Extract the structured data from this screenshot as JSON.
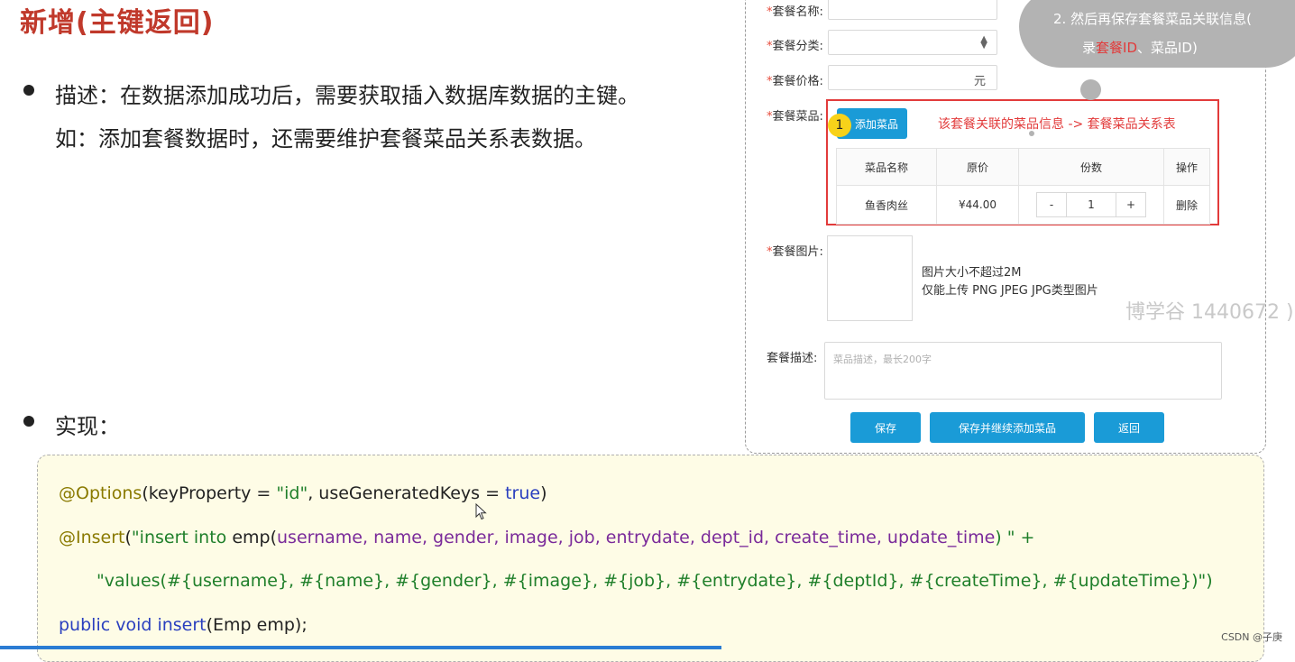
{
  "slide": {
    "title": "新增(主键返回)",
    "description_label": "描述：在数据添加成功后，需要获取插入数据库数据的主键。",
    "description_example": "如：添加套餐数据时，还需要维护套餐菜品关系表数据。",
    "implementation_label": "实现："
  },
  "form": {
    "name_label": "套餐名称:",
    "category_label": "套餐分类:",
    "price_label": "套餐价格:",
    "price_unit": "元",
    "dishes_label": "套餐菜品:",
    "add_dish_button": "添加菜品",
    "step_badge": "1",
    "dish_relation_note": "该套餐关联的菜品信息 -> 套餐菜品关系表",
    "table": {
      "headers": [
        "菜品名称",
        "原价",
        "份数",
        "操作"
      ],
      "rows": [
        {
          "name": "鱼香肉丝",
          "price": "¥44.00",
          "qty": "1",
          "action": "删除"
        }
      ],
      "minus": "-",
      "plus": "+"
    },
    "image_label": "套餐图片:",
    "image_hint_1": "图片大小不超过2M",
    "image_hint_2": "仅能上传 PNG JPEG JPG类型图片",
    "desc_label": "套餐描述:",
    "desc_placeholder": "菜品描述，最长200字",
    "save_button": "保存",
    "save_continue_button": "保存并继续添加菜品",
    "back_button": "返回",
    "required_mark": "*"
  },
  "cloud": {
    "line1": "2.  然后再保存套餐菜品关联信息(",
    "line2_prefix": "录",
    "line2_red1": "套餐ID",
    "line2_mid": "、菜品ID)"
  },
  "watermark": "博学谷 1440672 )",
  "code": {
    "line1_ann": "@Options",
    "line1_rest": "(keyProperty = ",
    "line1_str": "\"id\"",
    "line1_mid": ", useGeneratedKeys = ",
    "line1_kw": "true",
    "line1_end": ")",
    "line2_ann": "@Insert",
    "line2_open": "(",
    "line2_str1": "\"insert into",
    "line2_tbl": " emp(",
    "line2_cols": "username, name, gender, image, job, entrydate, dept_id, create_time, update_time",
    "line2_close": ") \" +",
    "line3_str": "\"values(",
    "line3_vals": "#{username}, #{name}, #{gender}, #{image}, #{job}, #{entrydate}, #{deptId}, #{createTime}, #{updateTime}",
    "line3_end": ")\")",
    "line4_kw": "public void insert",
    "line4_rest": "(Emp emp);"
  },
  "footer": "CSDN @子庚",
  "colors": {
    "title": "#c0392b",
    "accent_blue": "#1a9bd7",
    "highlight_red": "#e23b3b",
    "code_bg": "#fefce6"
  }
}
